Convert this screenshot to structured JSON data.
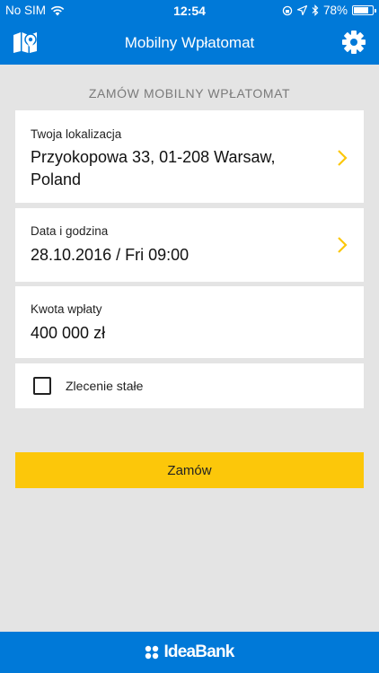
{
  "status_bar": {
    "carrier": "No SIM",
    "time": "12:54",
    "battery": "78%",
    "battery_level": 0.78
  },
  "nav": {
    "title": "Mobilny Wpłatomat",
    "left_icon": "map-pin-icon",
    "right_icon": "gear-icon"
  },
  "section": {
    "title": "ZAMÓW MOBILNY WPŁATOMAT"
  },
  "location": {
    "label": "Twoja lokalizacja",
    "value": "Przyokopowa 33, 01-208 Warsaw, Poland"
  },
  "datetime": {
    "label": "Data i godzina",
    "value": "28.10.2016 / Fri 09:00"
  },
  "amount": {
    "label": "Kwota wpłaty",
    "value": "400 000 zł"
  },
  "standing_order": {
    "label": "Zlecenie stałe",
    "checked": false
  },
  "order_button": {
    "label": "Zamów"
  },
  "footer": {
    "brand": "IdeaBank"
  },
  "colors": {
    "primary": "#0079d8",
    "accent": "#fcc70a",
    "background": "#e4e4e4"
  }
}
